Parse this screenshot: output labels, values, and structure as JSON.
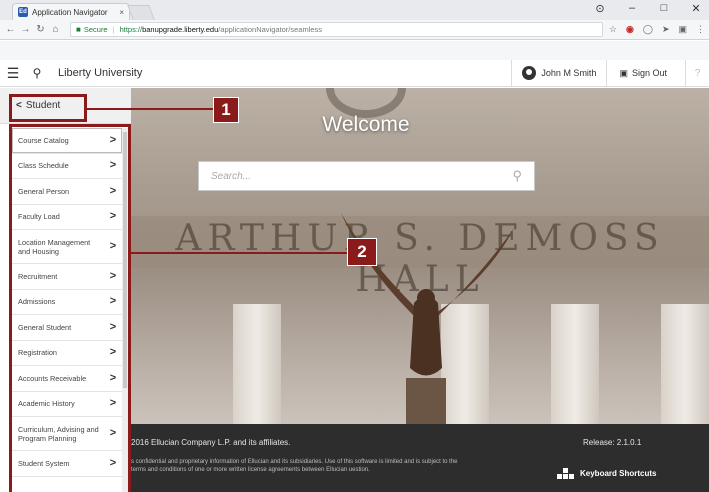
{
  "browser": {
    "tab_title": "Application Navigator",
    "tab_close": "×",
    "favicon": "Ed",
    "secure_label": "Secure",
    "url_proto": "https://",
    "url_host": "banupgrade.liberty.edu",
    "url_path": "/applicationNavigator/seamless",
    "win_controls": {
      "profile": "⊙",
      "minimize": "–",
      "maximize": "□",
      "close": "✕"
    }
  },
  "header": {
    "institution": "Liberty University",
    "user_name": "John M Smith",
    "sign_out": "Sign Out",
    "help": "?"
  },
  "sidebar": {
    "back_label": "Student",
    "items": [
      {
        "label": "Course Catalog"
      },
      {
        "label": "Class Schedule"
      },
      {
        "label": "General Person"
      },
      {
        "label": "Faculty Load"
      },
      {
        "label": "Location Management and Housing"
      },
      {
        "label": "Recruitment"
      },
      {
        "label": "Admissions"
      },
      {
        "label": "General Student"
      },
      {
        "label": "Registration"
      },
      {
        "label": "Accounts Receivable"
      },
      {
        "label": "Academic History"
      },
      {
        "label": "Curriculum, Advising and Program Planning"
      },
      {
        "label": "Student System"
      }
    ]
  },
  "main": {
    "welcome": "Welcome",
    "search_placeholder": "Search...",
    "hall_text": "ARTHUR S. DEMOSS HALL"
  },
  "footer": {
    "copyright": "2016 Ellucian Company L.P. and its affiliates.",
    "release": "Release: 2.1.0.1",
    "legal": "s confidential and proprietary information of Ellucian and its subsidiaries. Use of this software is limited and is subject to the terms and conditions of one or more written license agreements between Ellucian uestion.",
    "keyboard_shortcuts": "Keyboard Shortcuts"
  },
  "callouts": {
    "one": "1",
    "two": "2"
  },
  "colors": {
    "callout": "#8b1a1a",
    "footer": "#2d2d2d"
  }
}
